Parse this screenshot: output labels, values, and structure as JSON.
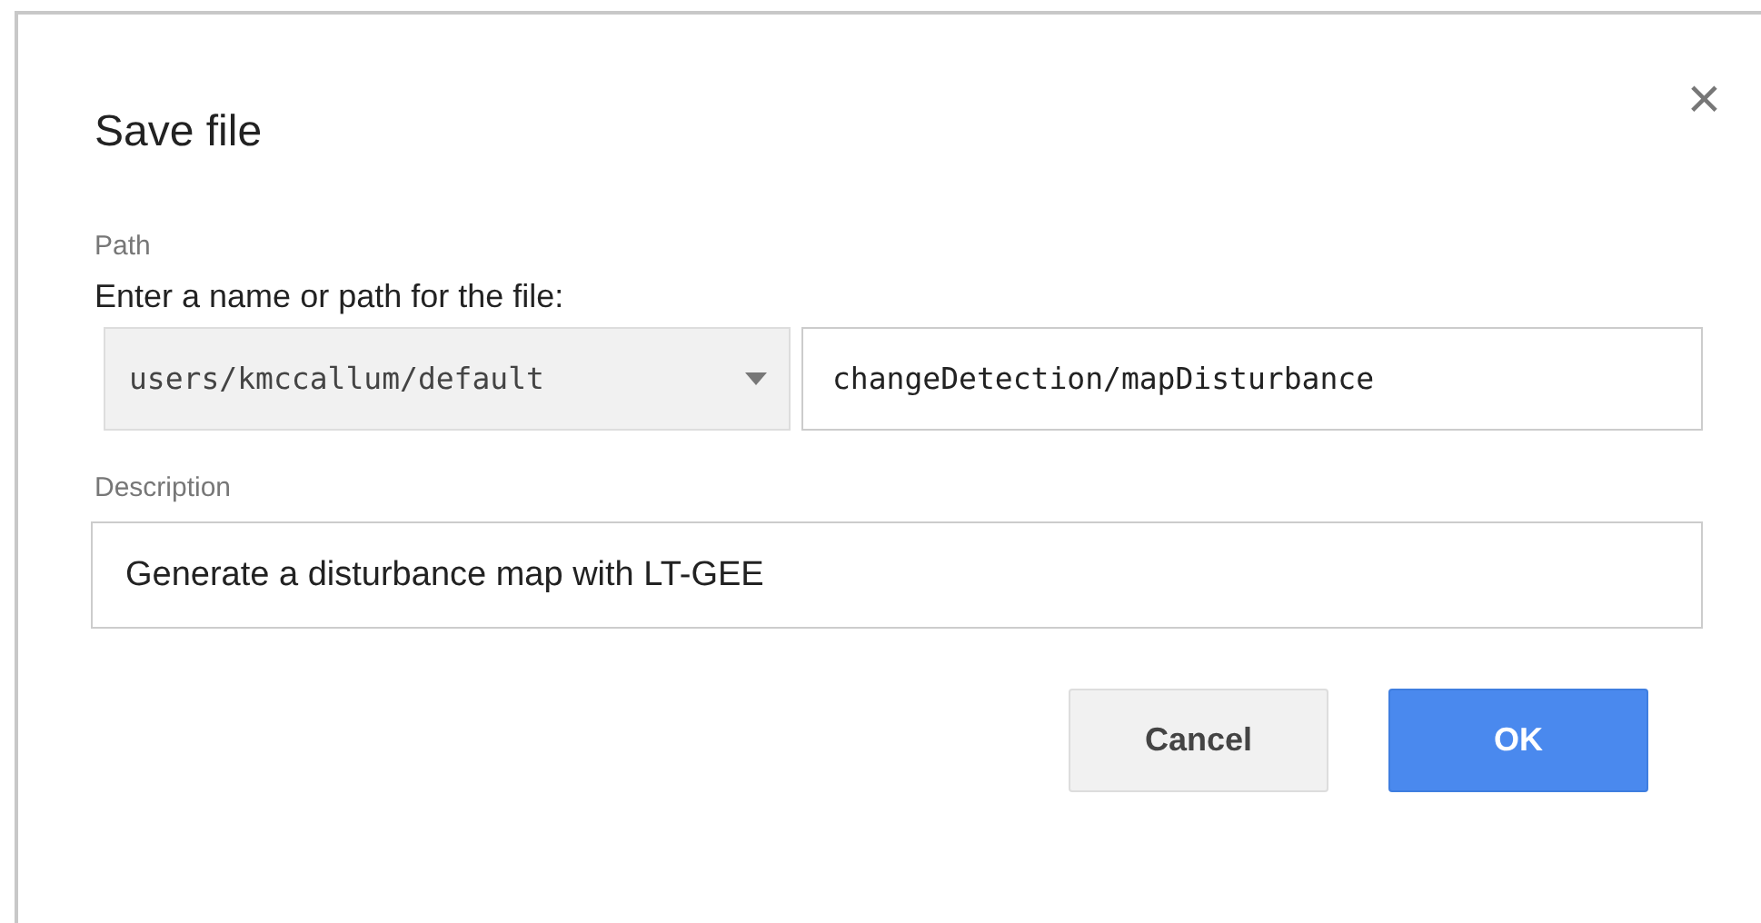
{
  "dialog": {
    "title": "Save file",
    "close": "×",
    "path": {
      "label": "Path",
      "instruction": "Enter a name or path for the file:",
      "folder": "users/kmccallum/default",
      "name": "changeDetection/mapDisturbance"
    },
    "description": {
      "label": "Description",
      "value": "Generate a disturbance map with LT-GEE"
    },
    "buttons": [
      {
        "label": "Cancel",
        "kind": "secondary"
      },
      {
        "label": "OK",
        "kind": "primary"
      }
    ]
  }
}
